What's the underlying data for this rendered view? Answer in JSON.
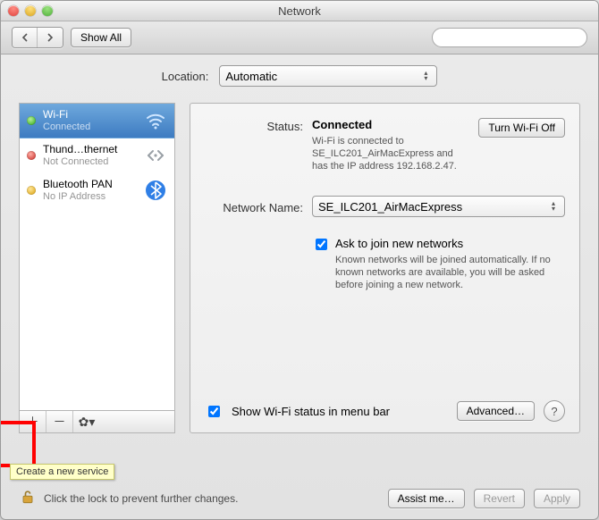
{
  "window": {
    "title": "Network"
  },
  "toolbar": {
    "show_all": "Show All",
    "search_placeholder": ""
  },
  "location": {
    "label": "Location:",
    "value": "Automatic"
  },
  "services": {
    "items": [
      {
        "name": "Wi-Fi",
        "status": "Connected",
        "dot": "green",
        "selected": true,
        "icon": "wifi"
      },
      {
        "name": "Thund…thernet",
        "status": "Not Connected",
        "dot": "red",
        "selected": false,
        "icon": "ethernet"
      },
      {
        "name": "Bluetooth PAN",
        "status": "No IP Address",
        "dot": "yellow",
        "selected": false,
        "icon": "bluetooth"
      }
    ],
    "add_tooltip": "Create a new service"
  },
  "detail": {
    "status_label": "Status:",
    "status_value": "Connected",
    "wifi_off_btn": "Turn Wi-Fi Off",
    "status_desc": "Wi-Fi is connected to SE_ILC201_AirMacExpress and has the IP address 192.168.2.47.",
    "network_name_label": "Network Name:",
    "network_name_value": "SE_ILC201_AirMacExpress",
    "ask_join_label": "Ask to join new networks",
    "ask_join_desc": "Known networks will be joined automatically. If no known networks are available, you will be asked before joining a new network.",
    "show_status_label": "Show Wi-Fi status in menu bar",
    "advanced_btn": "Advanced…"
  },
  "footer": {
    "lock_text": "Click the lock to prevent further changes.",
    "assist_btn": "Assist me…",
    "revert_btn": "Revert",
    "apply_btn": "Apply"
  }
}
